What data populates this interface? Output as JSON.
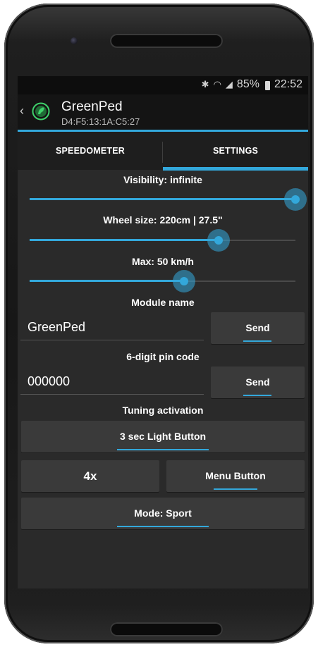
{
  "status": {
    "battery": "85%",
    "time": "22:52"
  },
  "appbar": {
    "title": "GreenPed",
    "subtitle": "D4:F5:13:1A:C5:27"
  },
  "tabs": [
    {
      "label": "SPEEDOMETER"
    },
    {
      "label": "SETTINGS"
    }
  ],
  "settings": {
    "visibility": {
      "label": "Visibility: infinite",
      "level": 1.0
    },
    "wheel": {
      "label": "Wheel size: 220cm | 27.5\"",
      "level": 0.71
    },
    "max": {
      "label": "Max: 50 km/h",
      "level": 0.58
    },
    "module_name": {
      "label": "Module name",
      "value": "GreenPed",
      "send": "Send"
    },
    "pin": {
      "label": "6-digit pin code",
      "value": "000000",
      "send": "Send"
    },
    "tuning": {
      "label": "Tuning activation",
      "light_button": "3 sec Light Button"
    },
    "count": "4x",
    "menu_button": "Menu Button",
    "mode": "Mode: Sport"
  },
  "colors": {
    "accent": "#33a8db",
    "background": "#2a2a2a"
  }
}
